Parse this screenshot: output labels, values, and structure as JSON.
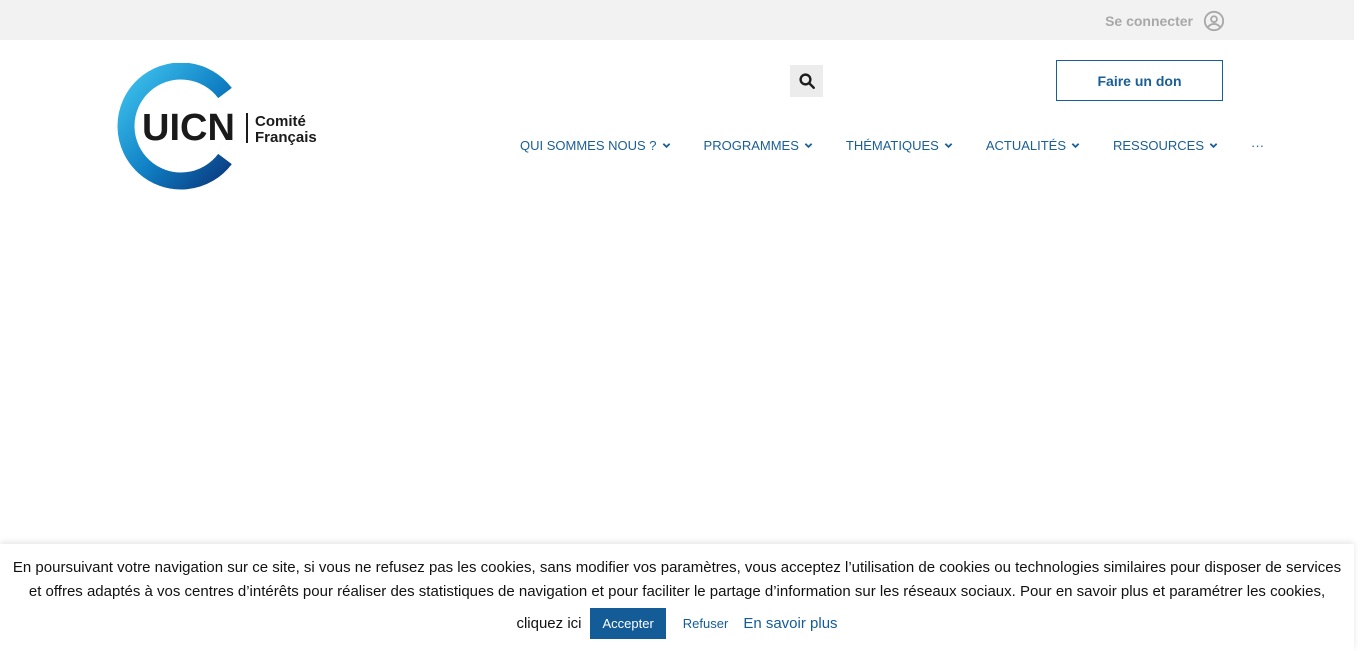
{
  "topbar": {
    "login_label": "Se connecter",
    "login_icon": "user-circle-icon"
  },
  "logo": {
    "brand": "UICN",
    "line1": "Comité",
    "line2": "Français"
  },
  "header": {
    "search_icon": "search-icon",
    "donate_label": "Faire un don"
  },
  "nav": {
    "items": [
      {
        "label": "QUI SOMMES NOUS ?"
      },
      {
        "label": "PROGRAMMES"
      },
      {
        "label": "THÉMATIQUES"
      },
      {
        "label": "ACTUALITÉS"
      },
      {
        "label": "RESSOURCES"
      }
    ],
    "more_label": "···"
  },
  "cookie": {
    "text": "En poursuivant votre navigation sur ce site, si vous ne refusez pas les cookies, sans modifier vos paramètres, vous acceptez l’utilisation de cookies ou technologies similaires pour disposer de services et offres adaptés à vos centres d’intérêts pour réaliser des statistiques de navigation et pour faciliter le partage d’information sur les réseaux sociaux. Pour en savoir plus et paramétrer les cookies,",
    "click_here": "cliquez ici",
    "accept_label": "Accepter",
    "refuse_label": "Refuser",
    "more_label": "En savoir plus"
  },
  "colors": {
    "brand_blue": "#1a5e96",
    "topbar_bg": "#f2f2f2"
  }
}
